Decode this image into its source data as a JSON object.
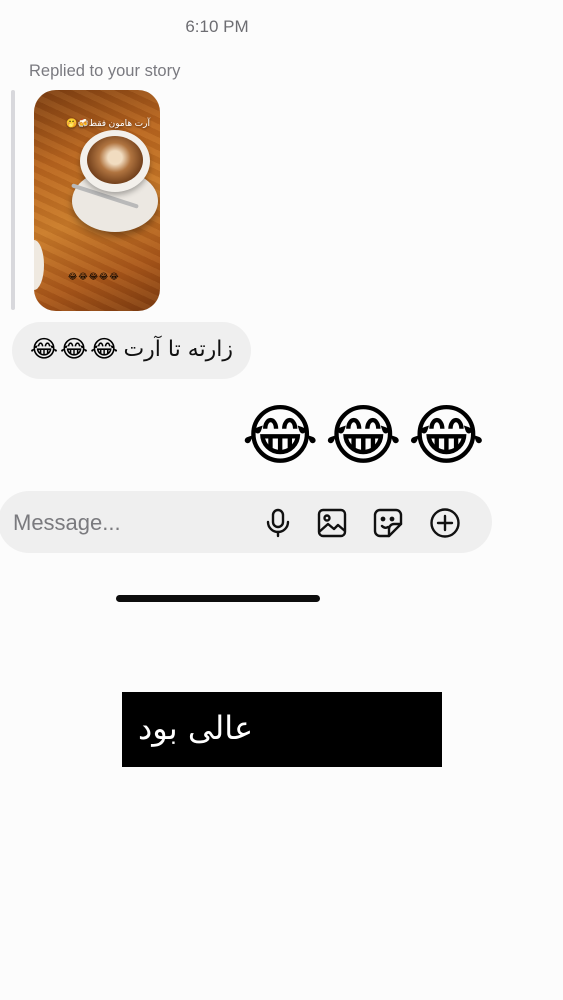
{
  "status": {
    "timestamp": "6:10 PM"
  },
  "story_reply": {
    "label": "Replied to your story",
    "story_caption": "آرت هامون فقط🍻🤭",
    "story_emoji_row": "😂😂😂😂😂"
  },
  "messages": [
    {
      "direction": "incoming",
      "text": "زارته  تا  آرت",
      "emojis": "😂😂😂"
    },
    {
      "direction": "outgoing",
      "emojis": "😂😂😂"
    }
  ],
  "composer": {
    "placeholder": "Message...",
    "icons": [
      "microphone-icon",
      "image-icon",
      "sticker-icon",
      "plus-circle-icon"
    ]
  },
  "overlay": {
    "text": "عالی بود",
    "emojis": "😂😂😂😂"
  }
}
